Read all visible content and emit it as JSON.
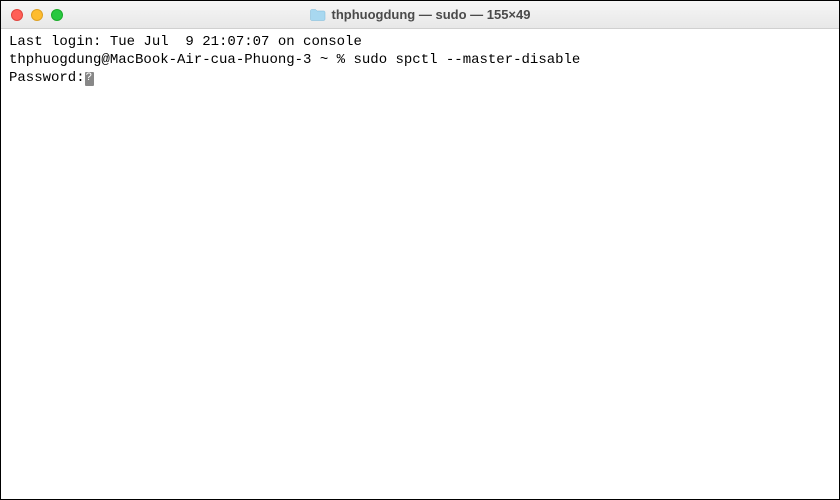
{
  "titlebar": {
    "title": "thphuogdung — sudo — 155×49"
  },
  "terminal": {
    "last_login_line": "Last login: Tue Jul  9 21:07:07 on console",
    "prompt_user": "thphuogdung@MacBook-Air-cua-Phuong-3",
    "prompt_path": "~",
    "prompt_symbol": "%",
    "command": "sudo spctl --master-disable",
    "password_label": "Password:"
  }
}
